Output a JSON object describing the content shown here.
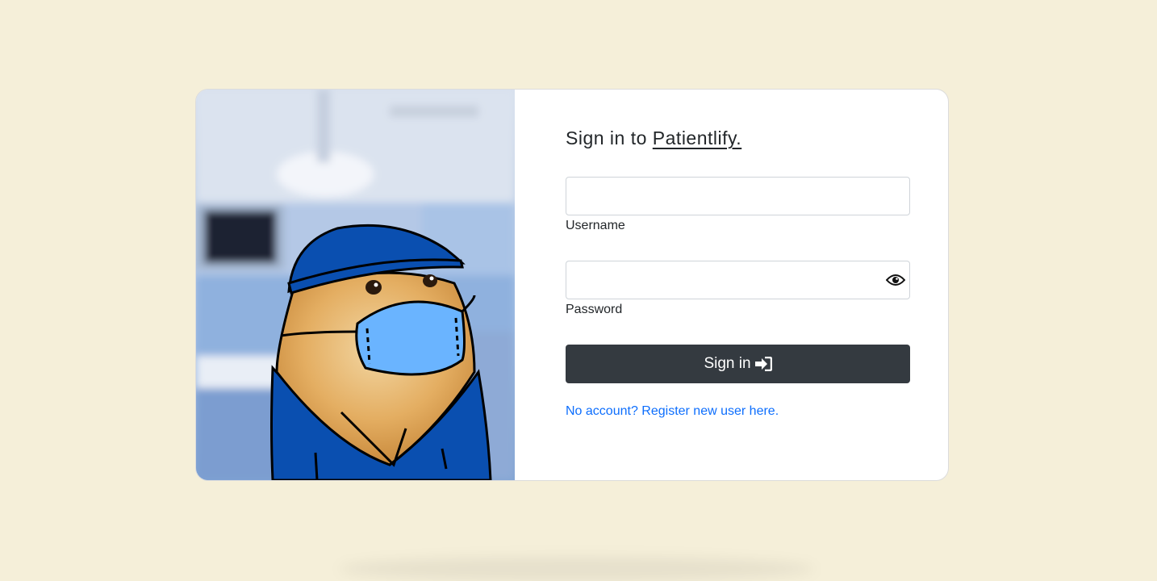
{
  "login": {
    "title_prefix": "Sign in to",
    "brand": "Patientlify.",
    "username_label": "Username",
    "username_value": "",
    "password_label": "Password",
    "password_value": "",
    "toggle_icon": "eye-icon",
    "signin_label": "Sign in",
    "signin_icon": "sign-in-icon",
    "register_text": "No account? Register new user here."
  },
  "hero": {
    "image": "cartoon-dog-surgeon-illustration"
  },
  "colors": {
    "background": "#f5efd9",
    "button": "#343a40",
    "link": "#0d6efd",
    "scrubs": "#0a4fb0",
    "mask": "#6ab4ff"
  }
}
